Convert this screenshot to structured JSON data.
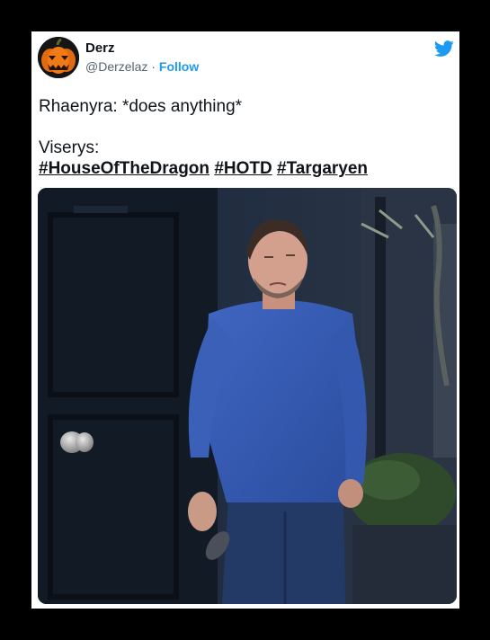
{
  "tweet": {
    "author_name": "Derz",
    "author_handle": "@Derzelaz",
    "separator": "·",
    "follow_label": "Follow",
    "text_line1": "Rhaenyra: *does anything*",
    "text_line2": "Viserys:",
    "hashtags": [
      "#HouseOfTheDragon",
      "#HOTD",
      "#Targaryen"
    ]
  },
  "icons": {
    "avatar": "pumpkin-avatar-icon",
    "brand": "twitter-bird-icon"
  },
  "colors": {
    "link": "#1d9bf0",
    "handle": "#536471",
    "text": "#0f1419",
    "background": "#000000",
    "card": "#ffffff"
  }
}
